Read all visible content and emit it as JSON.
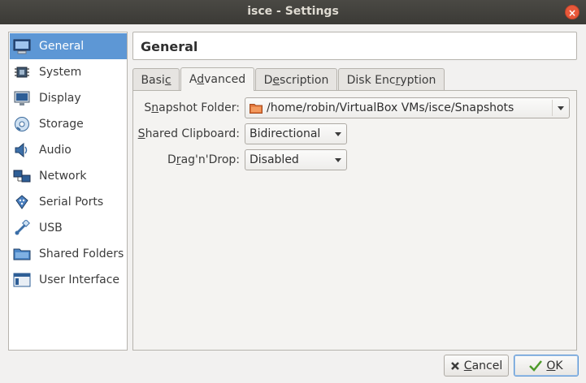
{
  "window": {
    "title": "isce - Settings",
    "close_glyph": "×"
  },
  "sidebar": {
    "items": [
      {
        "label": "General",
        "icon": "monitor-icon",
        "active": true
      },
      {
        "label": "System",
        "icon": "chip-icon",
        "active": false
      },
      {
        "label": "Display",
        "icon": "display-icon",
        "active": false
      },
      {
        "label": "Storage",
        "icon": "disk-icon",
        "active": false
      },
      {
        "label": "Audio",
        "icon": "speaker-icon",
        "active": false
      },
      {
        "label": "Network",
        "icon": "network-icon",
        "active": false
      },
      {
        "label": "Serial Ports",
        "icon": "serial-port-icon",
        "active": false
      },
      {
        "label": "USB",
        "icon": "usb-icon",
        "active": false
      },
      {
        "label": "Shared Folders",
        "icon": "shared-folder-icon",
        "active": false
      },
      {
        "label": "User Interface",
        "icon": "user-interface-icon",
        "active": false
      }
    ]
  },
  "page": {
    "title": "General"
  },
  "tabs": [
    {
      "pre": "Basi",
      "u": "c",
      "post": "",
      "active": false
    },
    {
      "pre": "A",
      "u": "d",
      "post": "vanced",
      "active": true
    },
    {
      "pre": "D",
      "u": "e",
      "post": "scription",
      "active": false
    },
    {
      "pre": "Disk Enc",
      "u": "r",
      "post": "yption",
      "active": false
    }
  ],
  "form": {
    "snapshot_folder": {
      "label_pre": "S",
      "label_u": "n",
      "label_post": "apshot Folder:",
      "value": "/home/robin/VirtualBox VMs/isce/Snapshots"
    },
    "shared_clipboard": {
      "label_pre": "",
      "label_u": "S",
      "label_post": "hared Clipboard:",
      "value": "Bidirectional"
    },
    "drag_n_drop": {
      "label_pre": "D",
      "label_u": "r",
      "label_post": "ag'n'Drop:",
      "value": "Disabled"
    }
  },
  "buttons": {
    "cancel": {
      "u": "C",
      "rest": "ancel"
    },
    "ok": {
      "u": "O",
      "rest": "K"
    }
  },
  "colors": {
    "selection": "#5d97d5",
    "titlebar": "#3b3a36",
    "close_button": "#e9583a",
    "folder": "#e0743a"
  }
}
